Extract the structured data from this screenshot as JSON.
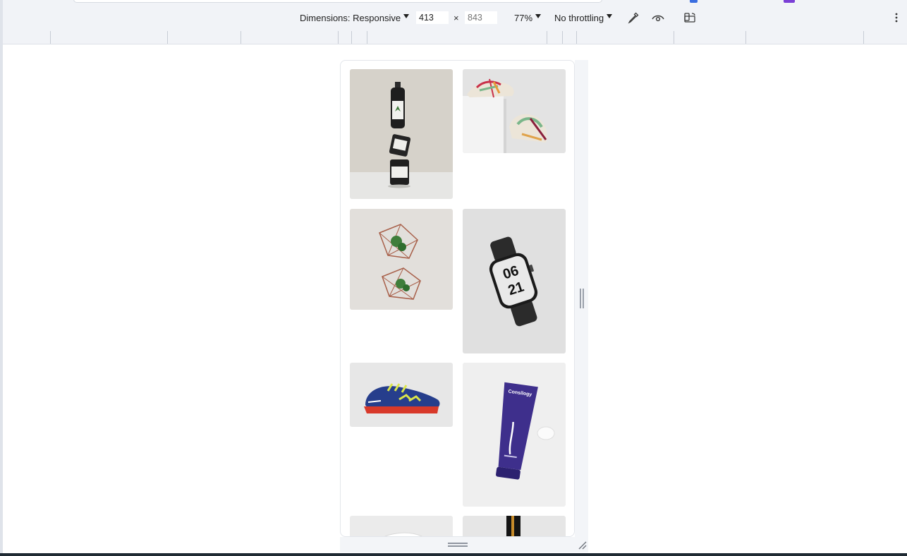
{
  "devtools_toolbar": {
    "dimensions_label": "Dimensions: Responsive",
    "width_value": "413",
    "height_placeholder": "843",
    "times_sign": "×",
    "zoom_label": "77%",
    "throttling_label": "No throttling",
    "icons": [
      "eyedropper-icon",
      "eye-icon",
      "rotate-device-icon",
      "more-vertical-icon"
    ]
  },
  "ruler": {
    "breakpoints": [
      "mobile-s",
      "mobile-m",
      "mobile-l",
      "tablet",
      "laptop",
      "laptop-l",
      "4k"
    ]
  },
  "gallery": {
    "tiles": [
      {
        "name": "product-bottles-tile",
        "subject": "stacked bottles and jars",
        "bg": "#d7d3cc"
      },
      {
        "name": "sneakers-on-box-tile",
        "subject": "sneakers on white box",
        "bg": "#e4e4e4"
      },
      {
        "name": "geometric-planters-tile",
        "subject": "geometric wire planters",
        "bg": "#e2dfdb"
      },
      {
        "name": "smartwatch-tile",
        "subject": "smartwatch",
        "bg": "#e1e1e1",
        "watch_text": "06 21"
      },
      {
        "name": "blue-shoe-tile",
        "subject": "blue sports shoe",
        "bg": "#e5e5e5"
      },
      {
        "name": "purple-tube-tile",
        "subject": "purple cream tube",
        "bg": "#eeeeee",
        "brand_text": "Consilogy"
      },
      {
        "name": "white-shoe-tile",
        "subject": "white shoe",
        "bg": "#ececec"
      },
      {
        "name": "dark-bottle-tile",
        "subject": "dark bottle",
        "bg": "#e8e8e8"
      }
    ]
  },
  "colors": {
    "toolbar_bg": "#f1f3f7",
    "viewport_border": "#e3e6eb",
    "taskbar": "#1f2a33"
  }
}
